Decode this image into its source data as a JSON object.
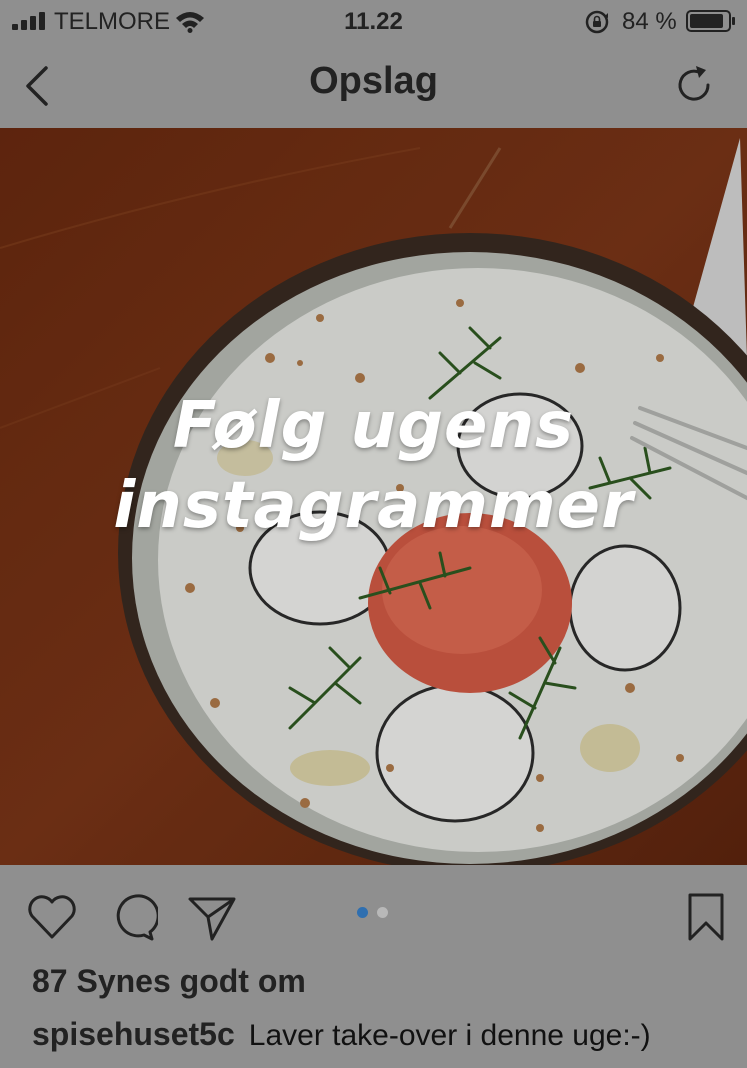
{
  "status": {
    "carrier": "TELMORE",
    "time": "11.22",
    "battery": "84 %",
    "icons": [
      "signal-icon",
      "wifi-icon",
      "orientation-lock-icon",
      "battery-icon"
    ]
  },
  "navbar": {
    "title": "Opslag",
    "back_icon": "chevron-left-icon",
    "refresh_icon": "refresh-icon"
  },
  "post": {
    "overlay_line1": "Følg ugens",
    "overlay_line2": "instagrammer",
    "carousel": {
      "pages": 2,
      "current": 1,
      "active_color": "#2f6fb0",
      "inactive_color": "#b8b8b8"
    },
    "actions": [
      "heart-icon",
      "comment-icon",
      "share-icon",
      "bookmark-icon"
    ],
    "likes": "87 Synes godt om",
    "caption_user": "spisehuset5c",
    "caption_text": "Laver take-over i denne uge:-)"
  },
  "colors": {
    "dim_overlay": "#8f8f8f",
    "table": "#7a3315",
    "plate": "#e9ebe6",
    "roe": "#d9604a",
    "dill": "#2f5a22"
  }
}
